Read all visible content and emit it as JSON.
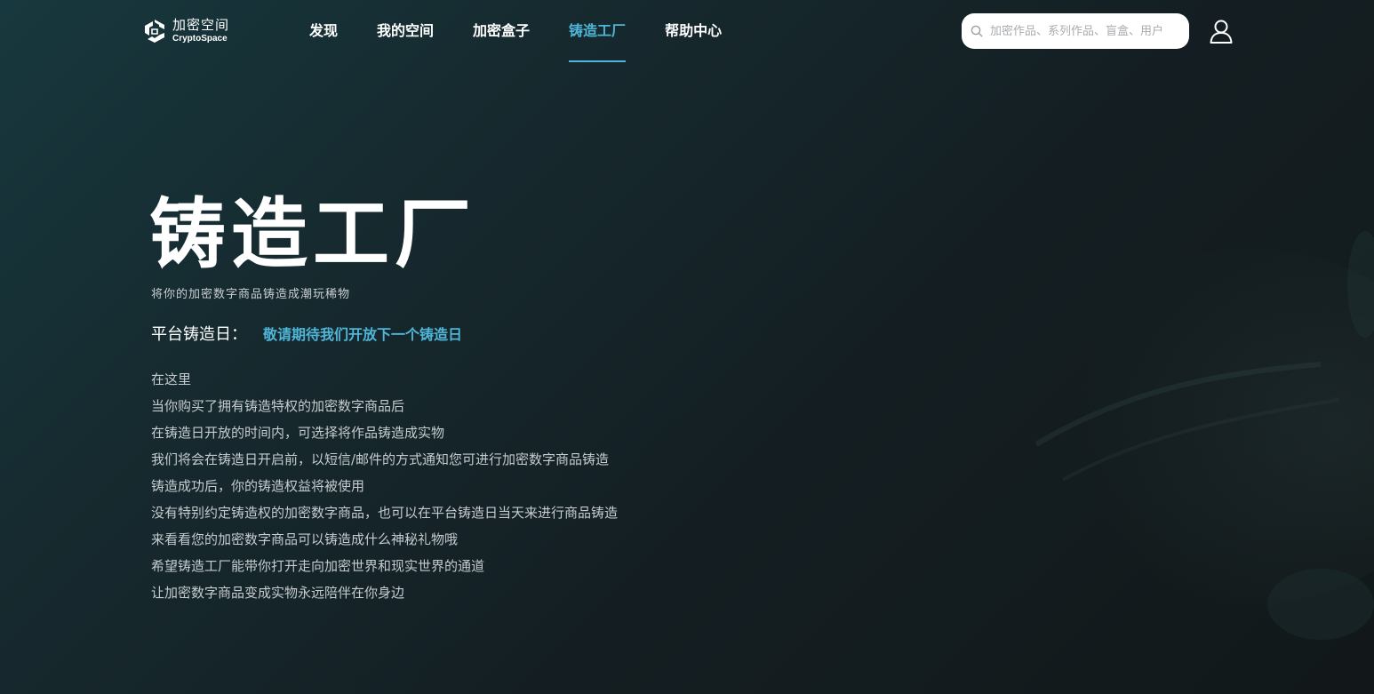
{
  "brand": {
    "name_cn": "加密空间",
    "name_en": "CryptoSpace"
  },
  "nav": {
    "items": [
      {
        "label": "发现",
        "active": false
      },
      {
        "label": "我的空间",
        "active": false
      },
      {
        "label": "加密盒子",
        "active": false
      },
      {
        "label": "铸造工厂",
        "active": true
      },
      {
        "label": "帮助中心",
        "active": false
      }
    ]
  },
  "search": {
    "placeholder": "加密作品、系列作品、盲盒、用户"
  },
  "hero": {
    "title": "铸造工厂",
    "subtitle": "将你的加密数字商品铸造成潮玩稀物"
  },
  "mint_day": {
    "label": "平台铸造日：",
    "value": "敬请期待我们开放下一个铸造日"
  },
  "description": [
    "在这里",
    "当你购买了拥有铸造特权的加密数字商品后",
    "在铸造日开放的时间内，可选择将作品铸造成实物",
    "我们将会在铸造日开启前，以短信/邮件的方式通知您可进行加密数字商品铸造",
    "铸造成功后，你的铸造权益将被使用",
    "没有特别约定铸造权的加密数字商品，也可以在平台铸造日当天来进行商品铸造",
    "来看看您的加密数字商品可以铸造成什么神秘礼物哦",
    "希望铸造工厂能带你打开走向加密世界和现实世界的通道",
    "让加密数字商品变成实物永远陪伴在你身边"
  ],
  "colors": {
    "accent": "#4fb6d8",
    "background_start": "#17383e",
    "background_end": "#121819"
  },
  "icons": {
    "logo": "cryptospace-logo-icon",
    "search": "search-icon",
    "user": "user-icon"
  }
}
